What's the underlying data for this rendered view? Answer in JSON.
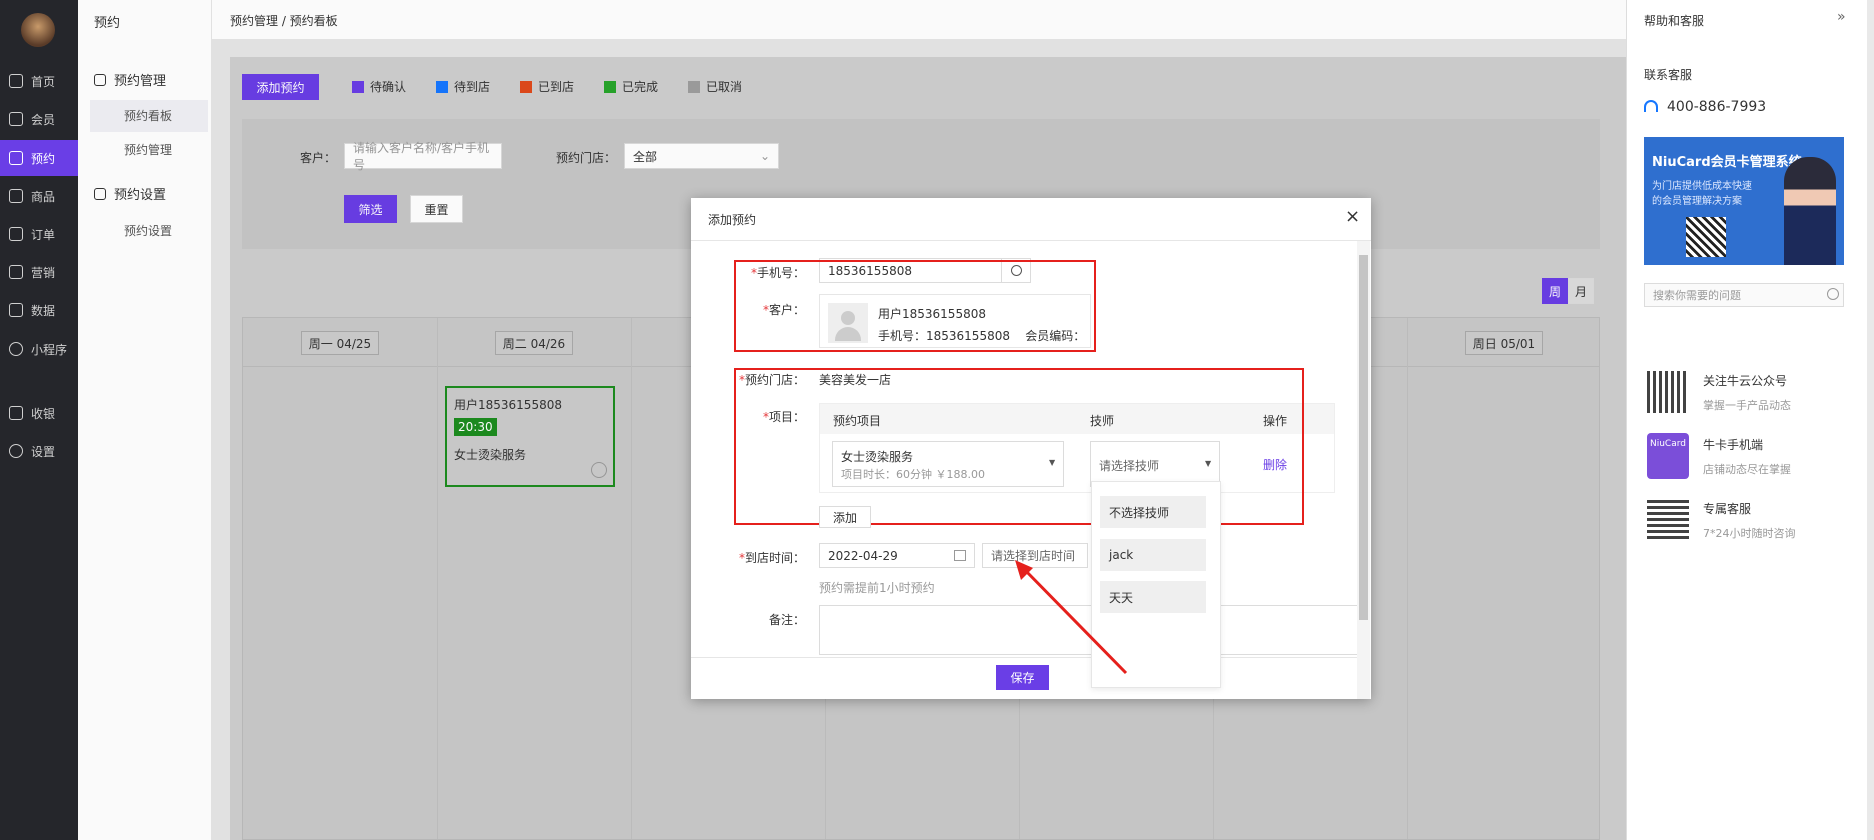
{
  "nav": {
    "items": [
      {
        "label": "首页",
        "icon": "home-icon"
      },
      {
        "label": "会员",
        "icon": "member-icon"
      },
      {
        "label": "预约",
        "icon": "calendar-icon",
        "active": true
      },
      {
        "label": "商品",
        "icon": "goods-icon"
      },
      {
        "label": "订单",
        "icon": "order-icon"
      },
      {
        "label": "营销",
        "icon": "marketing-icon"
      },
      {
        "label": "数据",
        "icon": "data-icon"
      },
      {
        "label": "小程序",
        "icon": "miniprogram-icon"
      },
      {
        "label": "收银",
        "icon": "cashier-icon"
      },
      {
        "label": "设置",
        "icon": "settings-icon"
      }
    ]
  },
  "subnav": {
    "title": "预约",
    "group1": "预约管理",
    "item1": "预约看板",
    "item2": "预约管理",
    "group2": "预约设置",
    "item3": "预约设置"
  },
  "breadcrumb": "预约管理 / 预约看板",
  "toolbar": {
    "add_label": "添加预约",
    "legend": [
      {
        "label": "待确认",
        "color": "#6a3ee6"
      },
      {
        "label": "待到店",
        "color": "#1677ff"
      },
      {
        "label": "已到店",
        "color": "#e04a1b"
      },
      {
        "label": "已完成",
        "color": "#27a52a"
      },
      {
        "label": "已取消",
        "color": "#9e9e9e"
      }
    ]
  },
  "filter": {
    "customer_label": "客户：",
    "customer_placeholder": "请输入客户名称/客户手机号",
    "store_label": "预约门店：",
    "store_value": "全部",
    "filter_btn": "筛选",
    "reset_btn": "重置"
  },
  "view": {
    "week": "周",
    "month": "月"
  },
  "calendar": {
    "days": [
      "周一 04/25",
      "周二 04/26",
      "周日 05/01"
    ],
    "card": {
      "name": "用户18536155808",
      "time": "20:30",
      "service": "女士烫染服务"
    }
  },
  "modal": {
    "title": "添加预约",
    "phone_label": "手机号：",
    "phone_value": "18536155808",
    "customer_label": "客户：",
    "customer_name": "用户18536155808",
    "customer_info": "手机号：18536155808    会员编码：",
    "store_label": "预约门店：",
    "store_value": "美容美发一店",
    "item_label": "项目：",
    "col_item": "预约项目",
    "col_tech": "技师",
    "col_op": "操作",
    "service_name": "女士烫染服务",
    "service_meta": "项目时长：60分钟 ￥188.00",
    "tech_placeholder": "请选择技师",
    "delete": "删除",
    "tech_options": [
      "不选择技师",
      "jack",
      "天天"
    ],
    "add": "添加",
    "time_label": "到店时间：",
    "date_value": "2022-04-29",
    "time_placeholder": "请选择到店时间",
    "hint": "预约需提前1小时预约",
    "note_label": "备注：",
    "save": "保存"
  },
  "help": {
    "title": "帮助和客服",
    "contact": "联系客服",
    "phone": "400-886-7993",
    "banner_title": "NiuCard会员卡管理系统",
    "banner_sub1": "为门店提供低成本快速",
    "banner_sub2": "的会员管理解决方案",
    "search_placeholder": "搜索你需要的问题",
    "links": [
      {
        "title": "关注牛云公众号",
        "sub": "掌握一手产品动态"
      },
      {
        "title": "牛卡手机端",
        "sub": "店铺动态尽在掌握",
        "badge": "NiuCard"
      },
      {
        "title": "专属客服",
        "sub": "7*24小时随时咨询"
      }
    ]
  }
}
